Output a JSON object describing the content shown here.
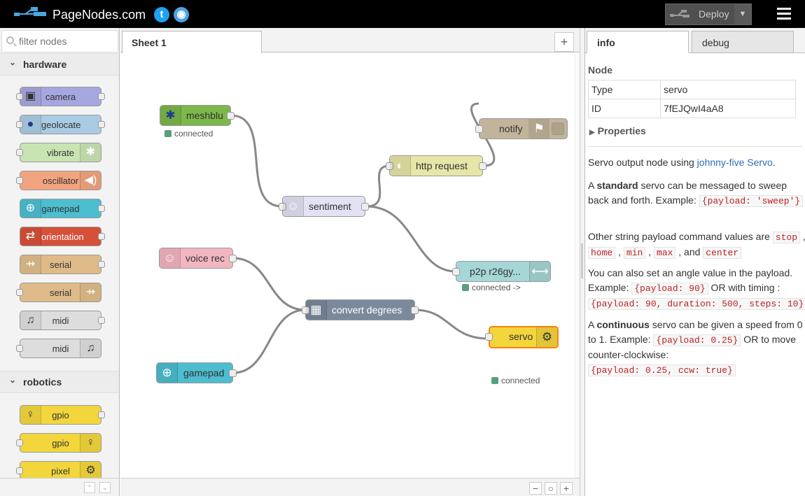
{
  "header": {
    "brand": "PageNodes.com",
    "twitter_icon": "t",
    "github_icon": "◉",
    "deploy_label": "Deploy"
  },
  "palette": {
    "filter_placeholder": "filter nodes",
    "categories": [
      {
        "label": "hardware",
        "nodes": [
          {
            "label": "camera",
            "icon": "camera-icon",
            "color": "#a6a6e0"
          },
          {
            "label": "geolocate",
            "icon": "globe-icon",
            "color": "#a9cbe3"
          },
          {
            "label": "vibrate",
            "icon": "vibrate-icon",
            "color": "#c9e4b3"
          },
          {
            "label": "oscillator",
            "icon": "speaker-icon",
            "color": "#f1a47f"
          },
          {
            "label": "gamepad",
            "icon": "gamepad-icon",
            "color": "#4dbdd0"
          },
          {
            "label": "orientation",
            "icon": "rotate-icon",
            "color": "#d64f39"
          },
          {
            "label": "serial",
            "icon": "usb-icon",
            "color": "#dfbb8a"
          },
          {
            "label": "serial",
            "icon": "usb-icon",
            "color": "#dfbb8a"
          },
          {
            "label": "midi",
            "icon": "music-note-icon",
            "color": "#dddddd"
          },
          {
            "label": "midi",
            "icon": "music-note-icon",
            "color": "#dddddd"
          }
        ]
      },
      {
        "label": "robotics",
        "nodes": [
          {
            "label": "gpio",
            "icon": "gpio-icon",
            "color": "#f2d63c"
          },
          {
            "label": "gpio",
            "icon": "gpio-icon",
            "color": "#f2d63c"
          },
          {
            "label": "pixel",
            "icon": "gear-icon",
            "color": "#f2d63c"
          }
        ]
      }
    ]
  },
  "workspace": {
    "tab_label": "Sheet 1",
    "add_tab": "+",
    "zoom": {
      "out": "−",
      "reset": "○",
      "in": "+"
    },
    "nodes": {
      "meshblu": {
        "label": "meshblu",
        "status": "connected",
        "color": "#7cb84a"
      },
      "notify": {
        "label": "notify",
        "color": "#c2b49b"
      },
      "http_request": {
        "label": "http request",
        "color": "#e6e6a8"
      },
      "sentiment": {
        "label": "sentiment",
        "color": "#e2e2f4"
      },
      "p2p": {
        "label": "p2p r26gy...",
        "status": "connected ->",
        "color": "#a6d6d6"
      },
      "voice_rec": {
        "label": "voice rec",
        "color": "#f3b6c0"
      },
      "convert_degrees": {
        "label": "convert degrees",
        "color": "#7a8a9c"
      },
      "servo": {
        "label": "servo",
        "status": "connected",
        "color": "#f2d63c"
      },
      "gamepad": {
        "label": "gamepad",
        "color": "#4dbdd0"
      }
    }
  },
  "sidebar": {
    "tabs": {
      "info": "info",
      "debug": "debug"
    },
    "node_heading": "Node",
    "type_key": "Type",
    "type_value": "servo",
    "id_key": "ID",
    "id_value": "7fEJQwI4aA8",
    "properties_label": "Properties",
    "description": {
      "intro_text": "Servo output node using ",
      "intro_link": "johnny-five Servo",
      "intro_end": ".",
      "p2_a": "A ",
      "p2_bold": "standard",
      "p2_b": " servo can be messaged to sweep back and forth. Example: ",
      "p2_code": "{payload: 'sweep'}",
      "p3_a": "Other string payload command values are ",
      "p3_codes": [
        "stop",
        "home",
        "min",
        "max",
        "center"
      ],
      "p3_and": "and",
      "p4_a": "You can also set an angle value in the payload. Example: ",
      "p4_code1": "{payload: 90}",
      "p4_b": " OR with timing : ",
      "p4_code2": "{payload: 90, duration: 500, steps: 10}",
      "p5_a": "A ",
      "p5_bold": "continuous",
      "p5_b": " servo can be given a speed from 0 to 1. Example: ",
      "p5_code1": "{payload: 0.25}",
      "p5_c": " OR to move counter-clockwise:",
      "p5_code2": "{payload: 0.25, ccw: true}"
    }
  }
}
